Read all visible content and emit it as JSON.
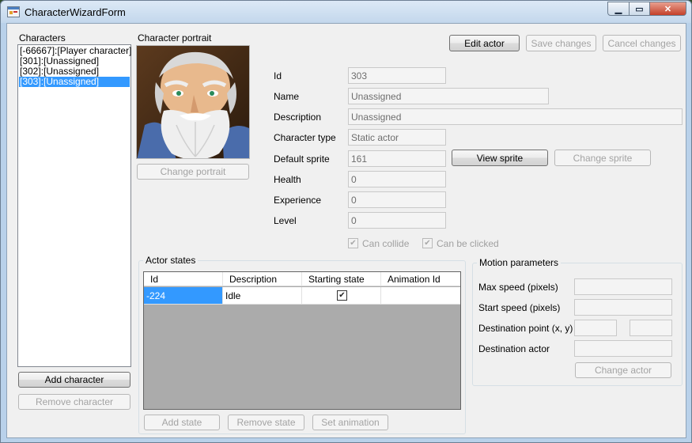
{
  "window": {
    "title": "CharacterWizardForm",
    "icon": "app-form-icon"
  },
  "characters": {
    "label": "Characters",
    "items": [
      "[-66667]:[Player character]",
      "[301]:[Unassigned]",
      "[302]:[Unassigned]",
      "[303]:[Unassigned]"
    ],
    "selected_index": 3,
    "add_label": "Add character",
    "remove_label": "Remove character"
  },
  "portrait": {
    "label": "Character portrait",
    "change_label": "Change portrait"
  },
  "toolbar": {
    "edit_label": "Edit actor",
    "save_label": "Save changes",
    "cancel_label": "Cancel changes"
  },
  "fields": {
    "id": {
      "label": "Id",
      "value": "303"
    },
    "name": {
      "label": "Name",
      "value": "Unassigned"
    },
    "description": {
      "label": "Description",
      "value": "Unassigned"
    },
    "character_type": {
      "label": "Character type",
      "value": "Static actor"
    },
    "default_sprite": {
      "label": "Default sprite",
      "value": "161"
    },
    "health": {
      "label": "Health",
      "value": "0"
    },
    "experience": {
      "label": "Experience",
      "value": "0"
    },
    "level": {
      "label": "Level",
      "value": "0"
    }
  },
  "sprite_buttons": {
    "view_label": "View sprite",
    "change_label": "Change sprite"
  },
  "checks": {
    "can_collide": {
      "label": "Can collide",
      "checked": true
    },
    "can_be_clicked": {
      "label": "Can be clicked",
      "checked": true
    }
  },
  "actor_states": {
    "label": "Actor states",
    "columns": [
      "Id",
      "Description",
      "Starting state",
      "Animation Id"
    ],
    "rows": [
      {
        "id": "-224",
        "description": "Idle",
        "starting_state": true,
        "animation_id": ""
      }
    ],
    "add_label": "Add state",
    "remove_label": "Remove state",
    "animation_label": "Set animation"
  },
  "motion": {
    "label": "Motion parameters",
    "max_speed_label": "Max speed (pixels)",
    "start_speed_label": "Start speed (pixels)",
    "destination_point_label": "Destination point (x, y)",
    "destination_actor_label": "Destination actor",
    "change_actor_label": "Change actor"
  },
  "colors": {
    "selection": "#3399ff",
    "client_bg": "#f0f0f0",
    "grid_bg": "#ababab"
  }
}
